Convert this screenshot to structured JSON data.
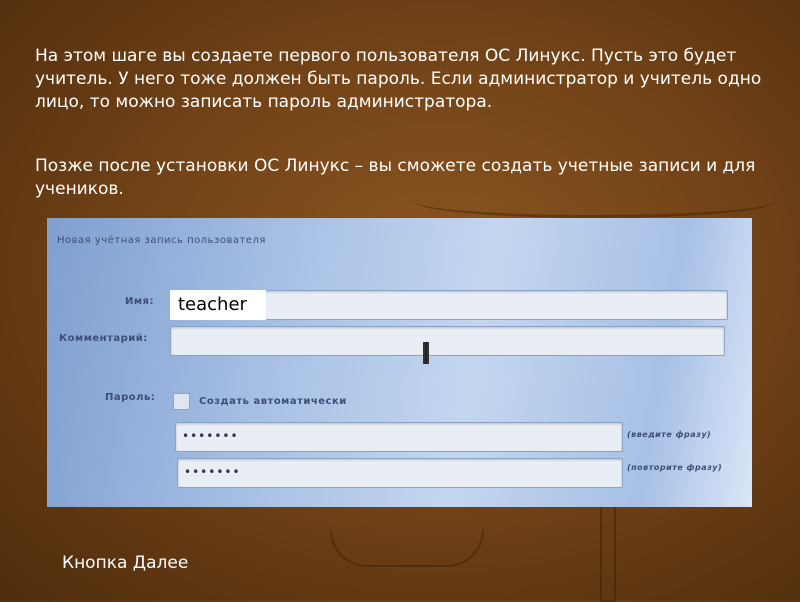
{
  "slide": {
    "paragraph1": "На этом шаге вы создаете первого пользователя ОС Линукс. Пусть это будет учитель. У него тоже должен быть пароль. Если администратор и учитель одно лицо, то можно записать пароль администратора.",
    "paragraph2": "Позже после установки ОС Линукс – вы сможете создать учетные записи и для учеников.",
    "footer": "Кнопка Далее"
  },
  "form": {
    "title": "Новая учётная запись пользователя",
    "name_label": "Имя:",
    "name_value": "teacher",
    "comment_label": "Комментарий:",
    "comment_value": "",
    "password_label": "Пароль:",
    "auto_checkbox_label": "Создать автоматически",
    "auto_checked": false,
    "password_value": "•••••••",
    "password_hint": "(введите фразу)",
    "confirm_value": "•••••••",
    "confirm_hint": "(повторите фразу)"
  }
}
